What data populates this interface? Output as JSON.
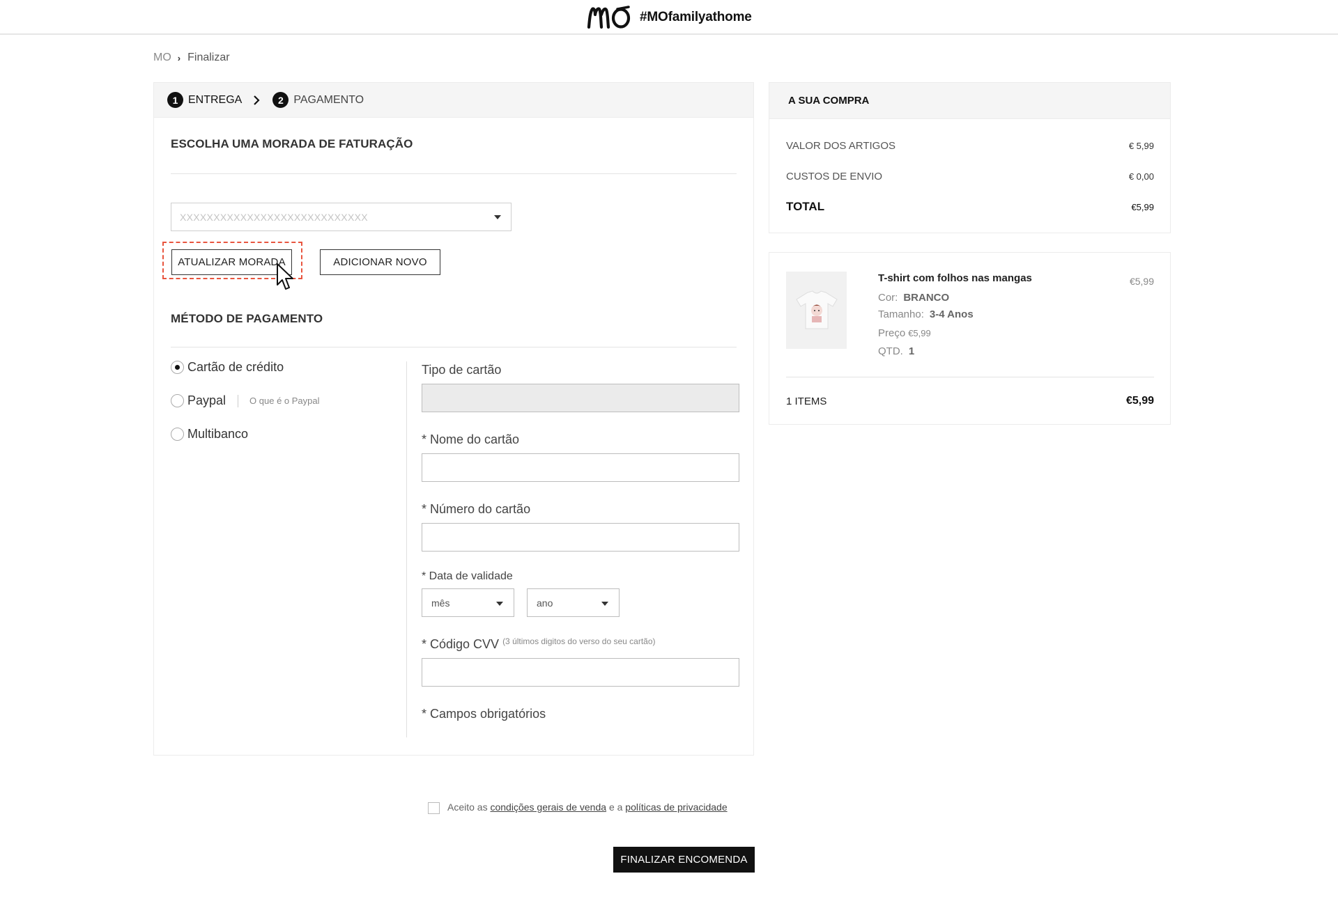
{
  "header": {
    "logo_text": "mo",
    "hashtag": "#MOfamilyathome"
  },
  "breadcrumb": {
    "home": "MO",
    "current": "Finalizar"
  },
  "steps": [
    {
      "num": "1",
      "label": "ENTREGA"
    },
    {
      "num": "2",
      "label": "PAGAMENTO"
    }
  ],
  "billing": {
    "title": "ESCOLHA UMA MORADA DE FATURAÇÃO",
    "address_value": "XXXXXXXXXXXXXXXXXXXXXXXXXXXX",
    "update_label": "ATUALIZAR MORADA",
    "add_label": "ADICIONAR NOVO"
  },
  "payment": {
    "title": "MÉTODO DE PAGAMENTO",
    "methods": [
      {
        "label": "Cartão de crédito",
        "selected": true
      },
      {
        "label": "Paypal",
        "selected": false
      },
      {
        "label": "Multibanco",
        "selected": false
      }
    ],
    "paypal_link": "O que é o Paypal",
    "card_type_label": "Tipo de cartão",
    "card_name_label": "* Nome do cartão",
    "card_number_label": "* Número do cartão",
    "expiry_label": "* Data de validade",
    "month_placeholder": "mês",
    "year_placeholder": "ano",
    "cvv_label": "* Código CVV",
    "cvv_hint": "(3 últimos digitos do verso do seu cartão)",
    "required_note": "* Campos obrigatórios"
  },
  "terms": {
    "prefix": "Aceito as",
    "link1": "condições gerais de venda",
    "middle": "e a",
    "link2": "políticas de privacidade"
  },
  "submit_label": "FINALIZAR ENCOMENDA",
  "summary": {
    "title": "A SUA COMPRA",
    "items_label": "VALOR DOS ARTIGOS",
    "items_value": "€ 5,99",
    "shipping_label": "CUSTOS DE ENVIO",
    "shipping_value": "€ 0,00",
    "total_label": "TOTAL",
    "total_value": "€5,99"
  },
  "cart": {
    "product_name": "T-shirt com folhos nas mangas",
    "product_price": "€5,99",
    "color_label": "Cor:",
    "color_value": "BRANCO",
    "size_label": "Tamanho:",
    "size_value": "3-4 Anos",
    "price_label": "Preço",
    "price_value": "€5,99",
    "qty_label": "QTD.",
    "qty_value": "1",
    "items_count": "1 ITEMS",
    "items_total": "€5,99"
  },
  "colors": {
    "highlight": "#e8553f",
    "primary": "#111111"
  }
}
